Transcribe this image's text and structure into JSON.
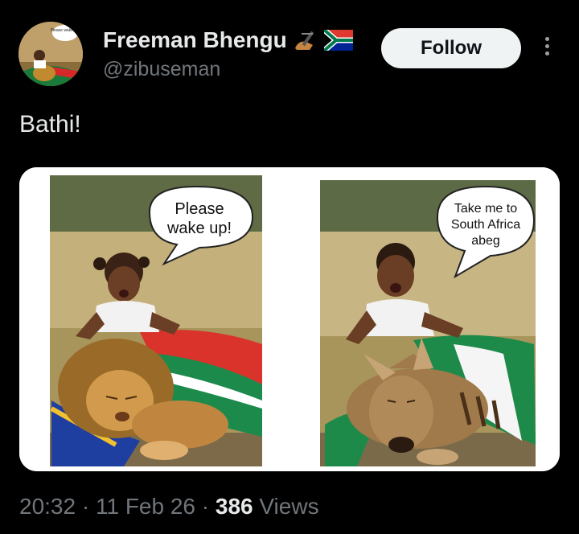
{
  "author": {
    "display_name": "Freeman Bhengu",
    "handle": "@zibuseman",
    "badges": [
      "writing-hand-emoji-icon",
      "south-africa-flag-icon"
    ]
  },
  "avatar": {
    "bubble_text": "Please wake up!"
  },
  "follow_label": "Follow",
  "tweet_text": "Bathi!",
  "media": {
    "left_panel": {
      "bubble_line1": "Please",
      "bubble_line2": "wake up!"
    },
    "right_panel": {
      "bubble_line1": "Take me to",
      "bubble_line2": "South Africa",
      "bubble_line3": "abeg"
    }
  },
  "footer": {
    "time": "20:32",
    "date": "11 Feb 26",
    "views_count": "386",
    "views_label": "Views",
    "separator": "·"
  },
  "colors": {
    "background": "#000000",
    "text_primary": "#e7e9ea",
    "text_secondary": "#71767b",
    "follow_bg": "#eff3f4"
  }
}
